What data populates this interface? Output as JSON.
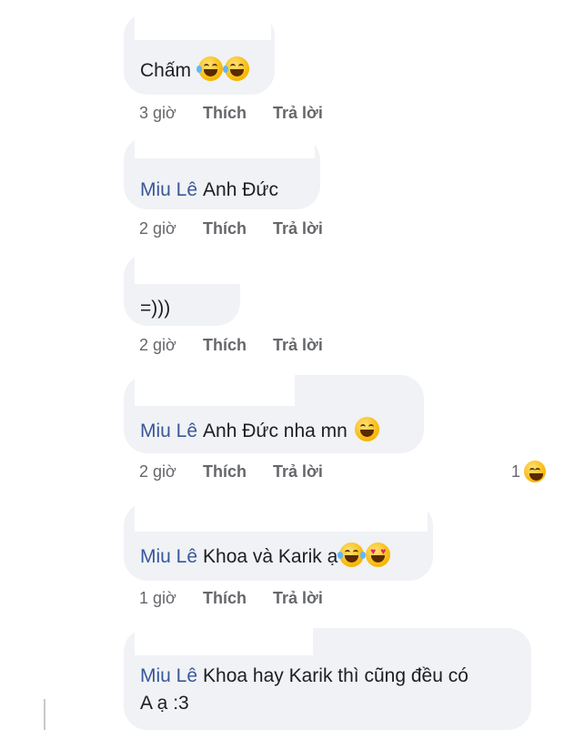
{
  "comments": [
    {
      "mention": "",
      "text": "Chấm",
      "emojis": [
        "rofl-emoji",
        "rofl-emoji"
      ],
      "time": "3 giờ",
      "like": "Thích",
      "reply": "Trả lời"
    },
    {
      "mention": "Miu Lê",
      "text": "Anh Đức",
      "emojis": [],
      "time": "2 giờ",
      "like": "Thích",
      "reply": "Trả lời"
    },
    {
      "mention": "",
      "text": "=)))",
      "emojis": [],
      "time": "2 giờ",
      "like": "Thích",
      "reply": "Trả lời"
    },
    {
      "mention": "Miu Lê",
      "text": "Anh Đức nha mn",
      "emojis": [
        "grinning-squint-emoji"
      ],
      "time": "2 giờ",
      "like": "Thích",
      "reply": "Trả lời",
      "reaction": {
        "count": "1",
        "icon": "haha-reaction-icon"
      }
    },
    {
      "mention": "Miu Lê",
      "text": "Khoa và Karik ạ",
      "emojis": [
        "tears-of-joy-emoji",
        "heart-eyes-emoji"
      ],
      "time": "1 giờ",
      "like": "Thích",
      "reply": "Trả lời"
    },
    {
      "mention": "Miu Lê",
      "text": "Khoa hay Karik thì cũng đều có",
      "text_line2": "A ạ :3",
      "emojis": []
    }
  ]
}
